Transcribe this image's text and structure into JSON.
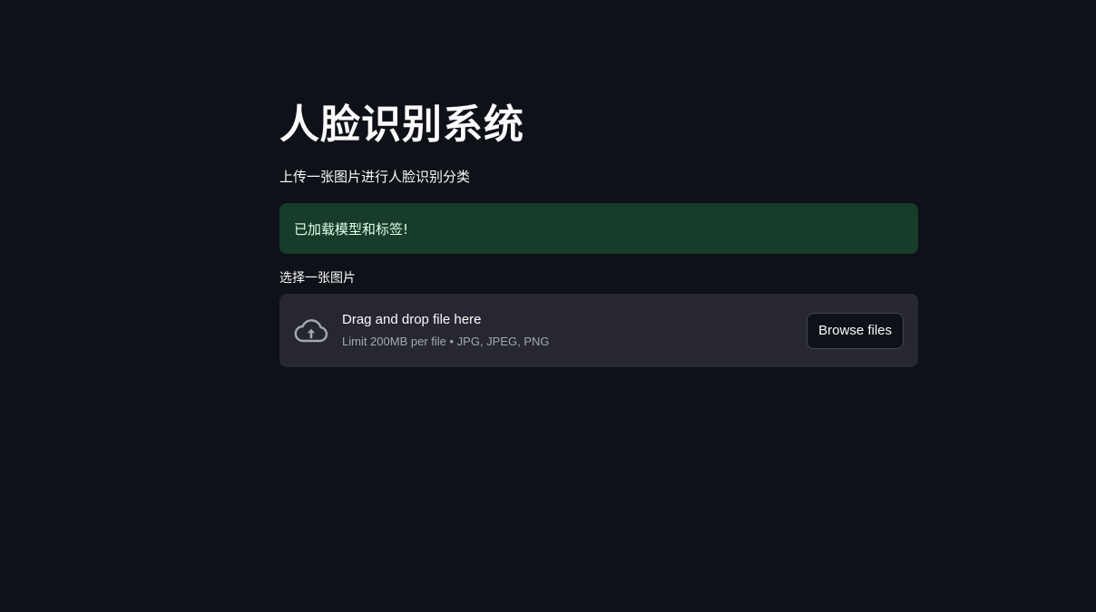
{
  "page": {
    "title": "人脸识别系统",
    "subtitle": "上传一张图片进行人脸识别分类"
  },
  "alert": {
    "message": "已加载模型和标签!",
    "background": "#173c29",
    "text_color": "#dffde9"
  },
  "uploader": {
    "label": "选择一张图片",
    "drop_title": "Drag and drop file here",
    "drop_hint": "Limit 200MB per file • JPG, JPEG, PNG",
    "button_label": "Browse files",
    "icon": "cloud-upload-icon"
  },
  "theme": {
    "background": "#0e1117",
    "surface": "#262730",
    "text": "#fafafa"
  }
}
